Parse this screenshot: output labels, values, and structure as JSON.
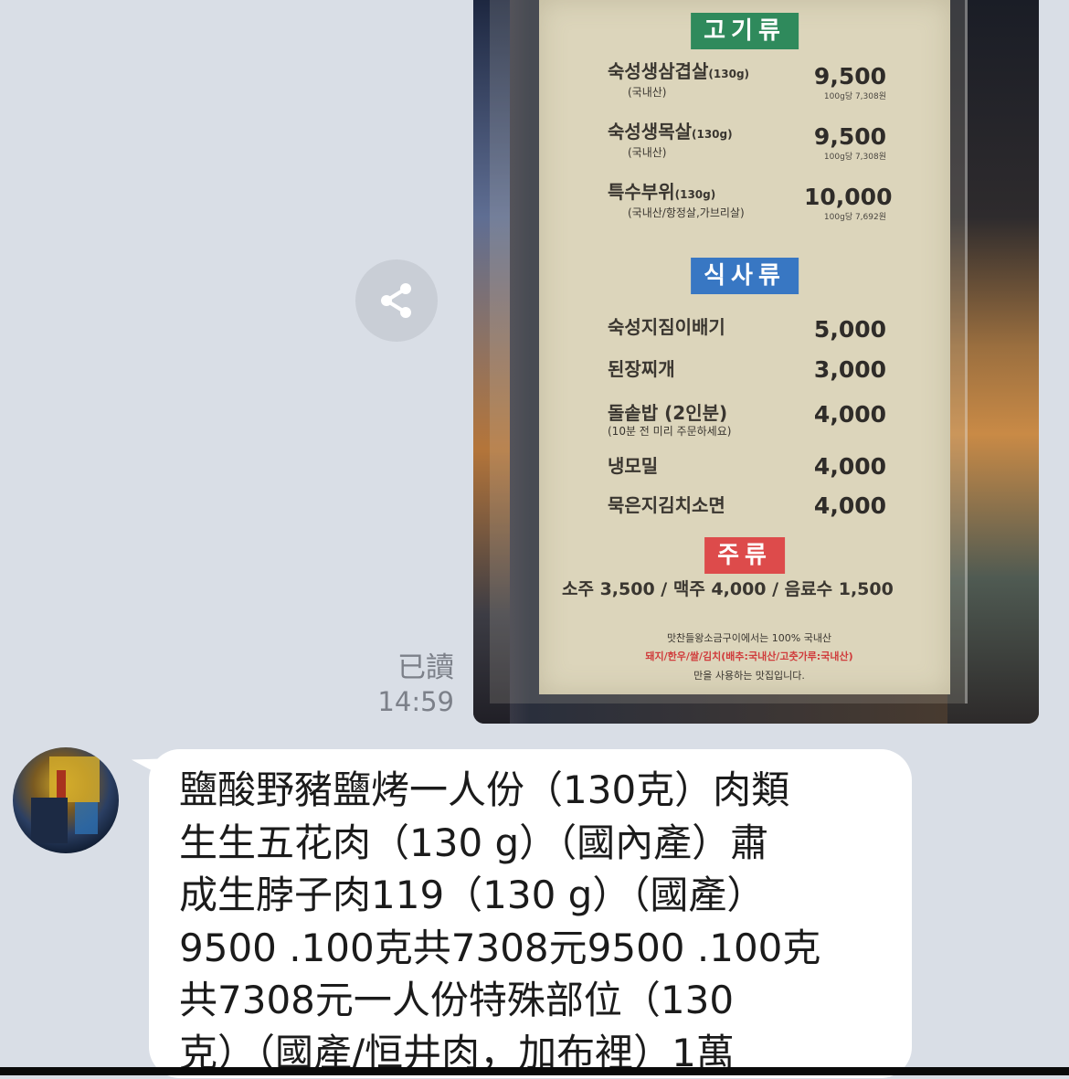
{
  "chat": {
    "share_icon": "share-icon",
    "outgoing": {
      "read_label": "已讀",
      "time": "14:59",
      "photo": {
        "menu_sections": [
          {
            "title": "고기류",
            "color": "#2f8a5c",
            "items": [
              {
                "name": "숙성생삼겹살",
                "weight": "(130g)",
                "origin": "(국내산)",
                "price": "9,500",
                "per_100g": "100g당 7,308원"
              },
              {
                "name": "숙성생목살",
                "weight": "(130g)",
                "origin": "(국내산)",
                "price": "9,500",
                "per_100g": "100g당 7,308원"
              },
              {
                "name": "특수부위",
                "weight": "(130g)",
                "origin": "(국내산/항정살,가브리살)",
                "price": "10,000",
                "per_100g": "100g당 7,692원"
              }
            ]
          },
          {
            "title": "식사류",
            "color": "#3877c3",
            "items": [
              {
                "name": "숙성지짐이배기",
                "price": "5,000"
              },
              {
                "name": "된장찌개",
                "price": "3,000"
              },
              {
                "name": "돌솥밥 (2인분)",
                "note": "(10분 전 미리 주문하세요)",
                "price": "4,000"
              },
              {
                "name": "냉모밀",
                "price": "4,000"
              },
              {
                "name": "묵은지김치소면",
                "price": "4,000"
              }
            ]
          },
          {
            "title": "주류",
            "color": "#dd4b4b",
            "line": "소주 3,500 / 맥주 4,000 / 음료수 1,500"
          }
        ],
        "footer": {
          "line1": "맛찬들왕소금구이에서는 100% 국내산",
          "line2": "돼지/한우/쌀/김치(배추:국내산/고춧가루:국내산)",
          "line3": "만을 사용하는 맛집입니다."
        }
      }
    },
    "incoming": {
      "avatar_icon": "avatar",
      "text": "鹽酸野豬鹽烤一人份（130克）肉類\n生生五花肉（130 g）（國內產）肅\n成生脖子肉119（130 g）（國產）\n9500 .100克共7308元9500 .100克\n共7308元一人份特殊部位（130\n克）（國產/恒井肉，加布裡）1萬"
    }
  }
}
